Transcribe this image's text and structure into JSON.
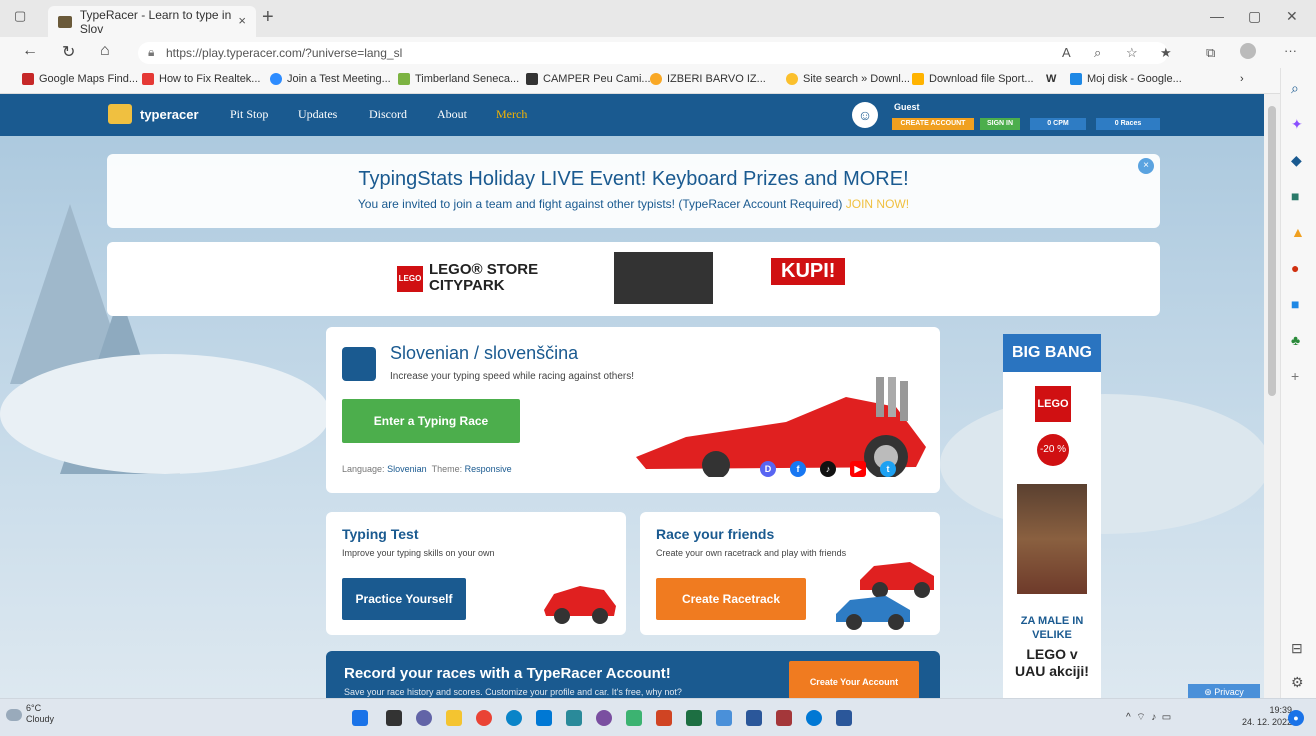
{
  "browser": {
    "tab_title": "TypeRacer - Learn to type in Slov",
    "tab_close": "×",
    "new_tab": "+",
    "url": "https://play.typeracer.com/?universe=lang_sl",
    "bookmarks": [
      {
        "label": "Google Maps Find...",
        "color": "#c62828"
      },
      {
        "label": "How to Fix Realtek...",
        "color": "#e53935"
      },
      {
        "label": "Join a Test Meeting...",
        "color": "#2d8cff"
      },
      {
        "label": "Timberland Seneca...",
        "color": "#7cb342"
      },
      {
        "label": "CAMPER Peu Cami...",
        "color": "#333333"
      },
      {
        "label": "IZBERI BARVO IZ...",
        "color": "#f9a825"
      },
      {
        "label": "Site search » Downl...",
        "color": "#fbc02d"
      },
      {
        "label": "Download file Sport...",
        "color": "#ffb300"
      },
      {
        "label": "Moj disk - Google...",
        "color": "#1e88e5"
      }
    ]
  },
  "nav": {
    "logo": "typeracer",
    "links": [
      "Pit Stop",
      "Updates",
      "Discord",
      "About",
      "Merch"
    ],
    "guest": "Guest",
    "create_account": "CREATE ACCOUNT",
    "sign_in": "SIGN IN",
    "cpm": "0 CPM",
    "races": "0 Races"
  },
  "banner": {
    "title": "TypingStats Holiday LIVE Event! Keyboard Prizes and MORE!",
    "text": "You are invited to join a team and fight against other typists! (TypeRacer Account Required)",
    "link": "JOIN NOW!",
    "close": "×"
  },
  "ad_top": {
    "brand": "LEGO",
    "store_line1": "LEGO® STORE",
    "store_line2": "CITYPARK",
    "cta": "KUPI!"
  },
  "main": {
    "title": "Slovenian / slovenščina",
    "subtitle": "Increase your typing speed while racing against others!",
    "enter_button": "Enter a Typing Race",
    "language_label": "Language:",
    "language_value": "Slovenian",
    "theme_label": "Theme:",
    "theme_value": "Responsive"
  },
  "typing_test": {
    "title": "Typing Test",
    "desc": "Improve your typing skills on your own",
    "button": "Practice Yourself"
  },
  "race_friends": {
    "title": "Race your friends",
    "desc": "Create your own racetrack and play with friends",
    "button": "Create Racetrack"
  },
  "account": {
    "title": "Record your races with a TypeRacer Account!",
    "desc": "Save your race history and scores. Customize your profile and car. It's free, why not?",
    "button": "Create Your Account"
  },
  "side_ad": {
    "brand": "BIG BANG",
    "lego": "LEGO",
    "discount": "-20 %",
    "line1": "ZA MALE IN",
    "line2": "VELIKE",
    "line3": "LEGO v",
    "line4": "UAU akciji!"
  },
  "privacy": "Privacy",
  "taskbar": {
    "temp": "6°C",
    "weather": "Cloudy",
    "time": "19:39",
    "date": "24. 12. 2022"
  }
}
